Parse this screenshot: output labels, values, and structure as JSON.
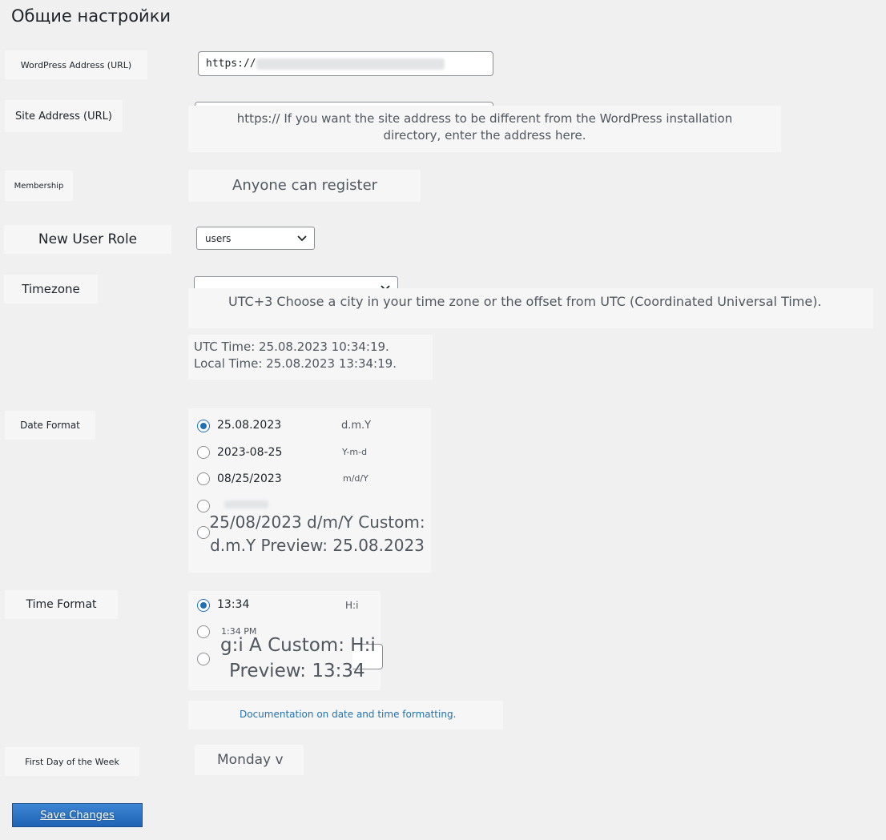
{
  "page": {
    "title": "Общие настройки"
  },
  "wp_address": {
    "label": "WordPress Address (URL)",
    "value": "https://"
  },
  "site_address": {
    "label": "Site Address (URL)",
    "description": "https:// If you want the site address to be different from the WordPress installation directory, enter the address here."
  },
  "membership": {
    "label": "Membership",
    "value": "Anyone can register"
  },
  "new_user_role": {
    "label": "New User Role",
    "selected": "users"
  },
  "timezone": {
    "label": "Timezone",
    "description": "UTC+3 Choose a city in your time zone or the offset from UTC (Coordinated Universal Time).",
    "time_info": "UTC Time: 25.08.2023 10:34:19. Local Time: 25.08.2023 13:34:19."
  },
  "date_format": {
    "label": "Date Format",
    "options": [
      {
        "text": "25.08.2023",
        "code": "d.m.Y",
        "checked": true
      },
      {
        "text": "2023-08-25",
        "code": "Y-m-d",
        "checked": false
      },
      {
        "text": "08/25/2023",
        "code": "m/d/Y",
        "checked": false
      }
    ],
    "custom_text": "25/08/2023 d/m/Y Custom: d.m.Y Preview: 25.08.2023"
  },
  "time_format": {
    "label": "Time Format",
    "options": [
      {
        "text": "13:34",
        "code": "H:i",
        "checked": true
      },
      {
        "text": "1:34 PM",
        "code": "",
        "checked": false
      }
    ],
    "custom_text_line1": "g:i A Custom: H:i",
    "custom_text_line2": "Preview: 13:34",
    "doc_link": "Documentation on date and time formatting."
  },
  "first_day": {
    "label": "First Day of the Week",
    "value": "Monday v"
  },
  "save_button": {
    "label": "Save Changes"
  },
  "colors": {
    "accent": "#2271b1",
    "background": "#f0f0f1"
  }
}
